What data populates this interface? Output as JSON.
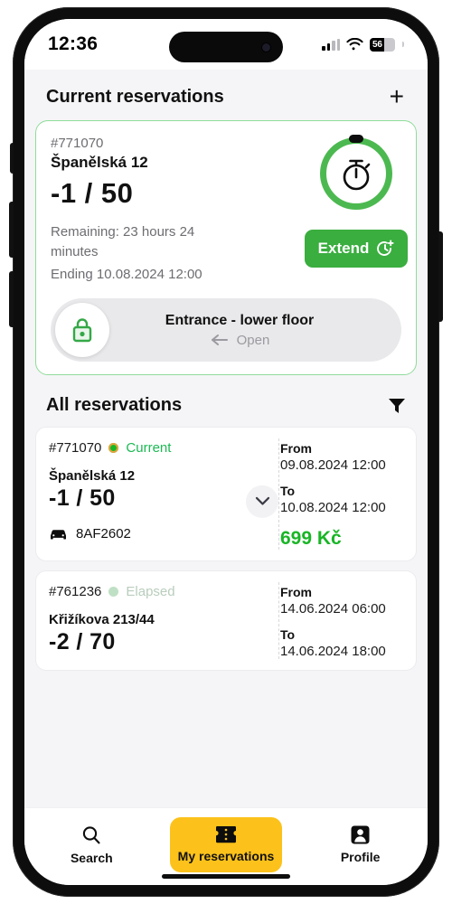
{
  "status_bar": {
    "time": "12:36",
    "battery_percent": "56",
    "signal_icon": "cellular-bars-icon",
    "wifi_icon": "wifi-icon",
    "battery_icon": "battery-icon"
  },
  "current_section": {
    "title": "Current reservations",
    "add_icon": "plus-icon",
    "card": {
      "reservation_id": "#771070",
      "address": "Španělská 12",
      "spot": "-1 / 50",
      "remaining": "Remaining: 23 hours 24 minutes",
      "ending": "Ending 10.08.2024 12:00",
      "extend_label": "Extend",
      "extend_icon": "clock-plus-icon",
      "timer_icon": "stopwatch-icon",
      "door": {
        "lock_icon": "lock-icon",
        "title": "Entrance - lower floor",
        "action": "Open",
        "arrow_icon": "arrow-left-icon"
      }
    }
  },
  "all_section": {
    "title": "All reservations",
    "filter_icon": "filter-funnel-icon",
    "rows": [
      {
        "reservation_id": "#771070",
        "status": "Current",
        "status_type": "current",
        "address": "Španělská 12",
        "spot": "-1 / 50",
        "plate": "8AF2602",
        "plate_icon": "car-icon",
        "expand_icon": "chevron-down-icon",
        "from_label": "From",
        "from_value": "09.08.2024 12:00",
        "to_label": "To",
        "to_value": "10.08.2024 12:00",
        "price": "699 Kč"
      },
      {
        "reservation_id": "#761236",
        "status": "Elapsed",
        "status_type": "elapsed",
        "address": "Křižíkova 213/44",
        "spot": "-2 / 70",
        "from_label": "From",
        "from_value": "14.06.2024 06:00",
        "to_label": "To",
        "to_value": "14.06.2024 18:00"
      }
    ]
  },
  "tab_bar": {
    "tabs": [
      {
        "label": "Search",
        "icon": "search-icon",
        "active": false
      },
      {
        "label": "My reservations",
        "icon": "ticket-icon",
        "active": true
      },
      {
        "label": "Profile",
        "icon": "person-icon",
        "active": false
      }
    ]
  },
  "colors": {
    "accent_green": "#3aae3f",
    "price_green": "#19b526",
    "tab_yellow": "#fcc21b",
    "card_border_green": "#8fdc9a",
    "muted_text": "#6d6d72"
  }
}
